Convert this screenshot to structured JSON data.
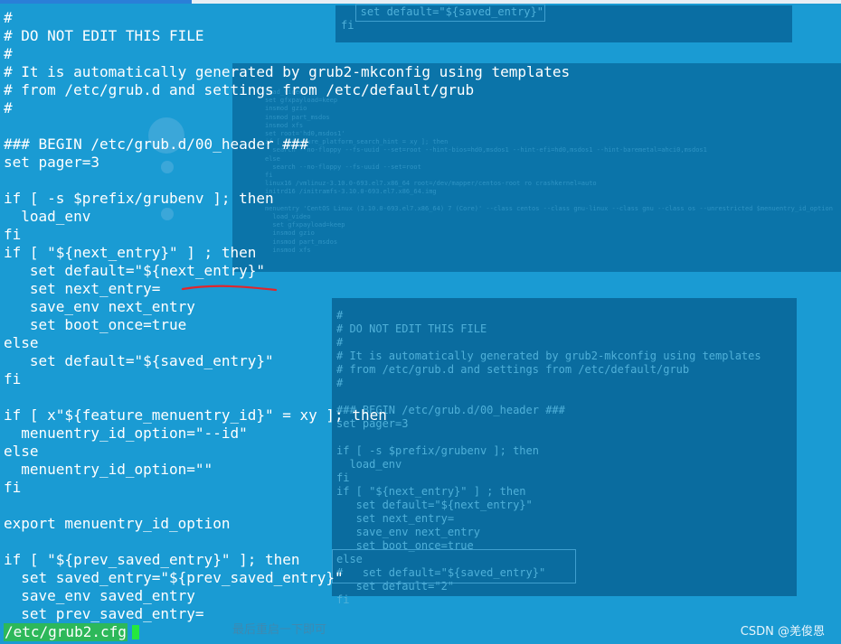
{
  "main_code": "#\n# DO NOT EDIT THIS FILE\n#\n# It is automatically generated by grub2-mkconfig using templates\n# from /etc/grub.d and settings from /etc/default/grub\n#\n\n### BEGIN /etc/grub.d/00_header ###\nset pager=3\n\nif [ -s $prefix/grubenv ]; then\n  load_env\nfi\nif [ \"${next_entry}\" ] ; then\n   set default=\"${next_entry}\"\n   set next_entry=\n   save_env next_entry\n   set boot_once=true\nelse\n   set default=\"${saved_entry}\"\nfi\n\nif [ x\"${feature_menuentry_id}\" = xy ]; then\n  menuentry_id_option=\"--id\"\nelse\n  menuentry_id_option=\"\"\nfi\n\nexport menuentry_id_option\n\nif [ \"${prev_saved_entry}\" ]; then\n  set saved_entry=\"${prev_saved_entry}\"\n  save_env saved_entry\n  set prev_saved_entry=",
  "status_line": "/etc/grub2.cfg",
  "panel_top_code": "   set default=\"${saved_entry}\"\nfi",
  "panel_low_code": "#\n# DO NOT EDIT THIS FILE\n#\n# It is automatically generated by grub2-mkconfig using templates\n# from /etc/grub.d and settings from /etc/default/grub\n#\n\n### BEGIN /etc/grub.d/00_header ###\nset pager=3\n\nif [ -s $prefix/grubenv ]; then\n  load_env\nfi\nif [ \"${next_entry}\" ] ; then\n   set default=\"${next_entry}\"\n   set next_entry=\n   save_env next_entry\n   set boot_once=true\nelse\n#   set default=\"${saved_entry}\"\n   set default=\"2\"\nfi",
  "panel_mid_code": "load_video\nset gfxpayload=keep\ninsmod gzio\ninsmod part_msdos\ninsmod xfs\nset root='hd0,msdos1'\nif [ x$feature_platform_search_hint = xy ]; then\n  search --no-floppy --fs-uuid --set=root --hint-bios=hd0,msdos1 --hint-efi=hd0,msdos1 --hint-baremetal=ahci0,msdos1\nelse\n  search --no-floppy --fs-uuid --set=root\nfi\nlinux16 /vmlinuz-3.10.0-693.el7.x86_64 root=/dev/mapper/centos-root ro crashkernel=auto\ninitrd16 /initramfs-3.10.0-693.el7.x86_64.img\n\nmenuentry 'CentOS Linux (3.10.0-693.el7.x86_64) 7 (Core)' --class centos --class gnu-linux --class gnu --class os --unrestricted $menuentry_id_option\n  load_video\n  set gfxpayload=keep\n  insmod gzio\n  insmod part_msdos\n  insmod xfs",
  "caption": "最后重启一下即可",
  "watermark": "CSDN @羌俊恩",
  "colors": {
    "background": "#1a9bd3",
    "text": "#ffffff",
    "status_bg": "#2db85a",
    "annotation_red": "#e0262c"
  }
}
